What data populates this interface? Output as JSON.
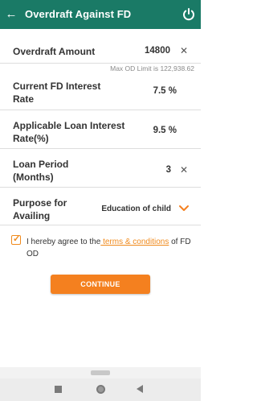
{
  "header": {
    "back_icon": "arrow-left-icon",
    "title": "Overdraft Against FD",
    "power_icon": "power-icon"
  },
  "colors": {
    "header_bg": "#1a7a66",
    "accent": "#f4801f"
  },
  "fields": {
    "overdraft_amount": {
      "label": "Overdraft Amount",
      "value": "14800",
      "hint": "Max OD Limit is 122,938.62"
    },
    "fd_rate": {
      "label": "Current FD Interest Rate",
      "value": "7.5 %"
    },
    "loan_rate": {
      "label": "Applicable Loan Interest Rate(%)",
      "value": "9.5 %"
    },
    "loan_period": {
      "label": "Loan Period (Months)",
      "value": "3"
    },
    "purpose": {
      "label": "Purpose for Availing",
      "value": "Education of child"
    }
  },
  "agreement": {
    "checked": true,
    "prefix": "I hereby agree to the",
    "link": " terms & conditions",
    "suffix": " of FD OD"
  },
  "continue_label": "CONTINUE",
  "clear_glyph": "✕"
}
